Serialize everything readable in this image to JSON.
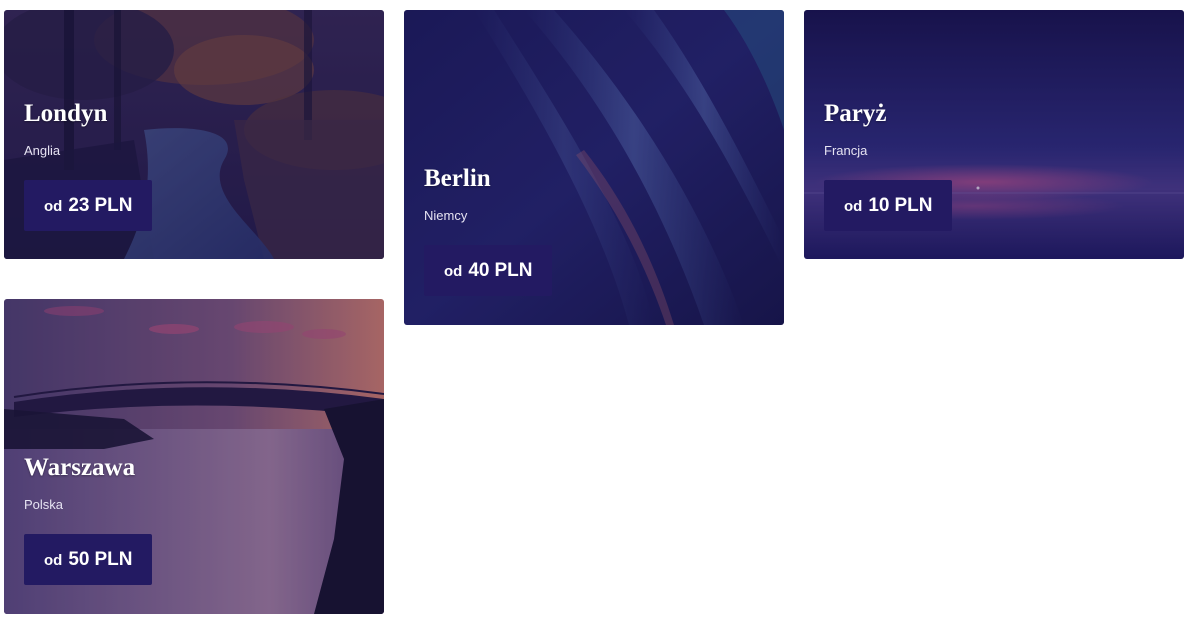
{
  "cards": [
    {
      "city": "Londyn",
      "country": "Anglia",
      "price_prefix": "od",
      "price": "23",
      "currency": "PLN",
      "image": "autumn-forest-river"
    },
    {
      "city": "Berlin",
      "country": "Niemcy",
      "price_prefix": "od",
      "price": "40",
      "currency": "PLN",
      "image": "dark-blue-glitter-feather"
    },
    {
      "city": "Paryż",
      "country": "Francja",
      "price_prefix": "od",
      "price": "10",
      "currency": "PLN",
      "image": "night-sky-lake-reflection"
    },
    {
      "city": "Warszawa",
      "country": "Polska",
      "price_prefix": "od",
      "price": "50",
      "currency": "PLN",
      "image": "bridge-over-river-sunset"
    }
  ],
  "colors": {
    "overlay": "#1e1650",
    "button_bg": "#231a62",
    "text": "#ffffff"
  }
}
